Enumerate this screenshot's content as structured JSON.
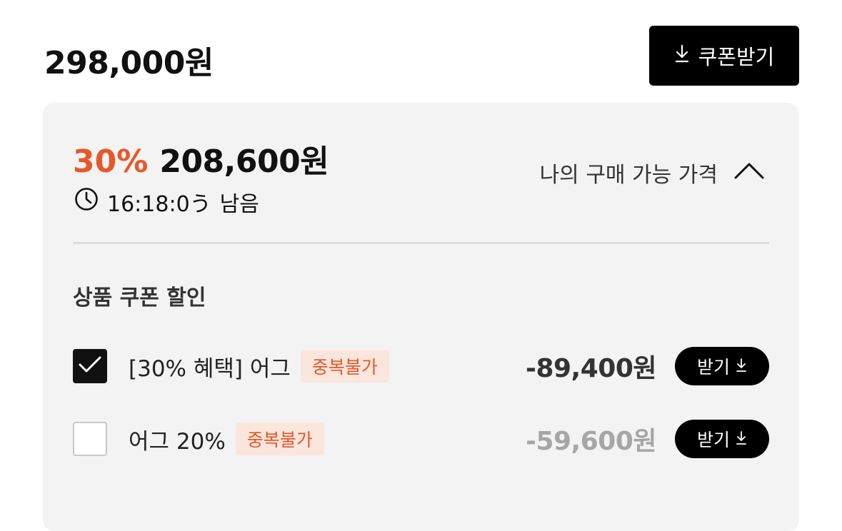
{
  "colors": {
    "accent": "#e8572a",
    "badge_bg": "#fbe6dd",
    "text_dark": "#111111",
    "text_muted": "#a6a6a6",
    "panel_bg": "#f3f3f3"
  },
  "header": {
    "original_price": "298,000원",
    "coupon_button_label": "쿠폰받기",
    "coupon_button_icon": "download-icon"
  },
  "price_panel": {
    "discount_rate": "30%",
    "sale_price": "208,600원",
    "timer_icon": "clock-icon",
    "timer_value": "16:18:0",
    "timer_cursor_glyph": "う",
    "timer_suffix": "남음",
    "my_price_label": "나의 구매 가능 가격",
    "my_price_toggle_icon": "chevron-up-icon",
    "section_title": "상품 쿠폰 할인",
    "coupons": [
      {
        "checked": true,
        "name": "[30% 혜택] 어그",
        "badge": "중복불가",
        "amount": "-89,400원",
        "button_label": "받기"
      },
      {
        "checked": false,
        "name": "어그 20%",
        "badge": "중복불가",
        "amount": "-59,600원",
        "button_label": "받기"
      }
    ]
  }
}
